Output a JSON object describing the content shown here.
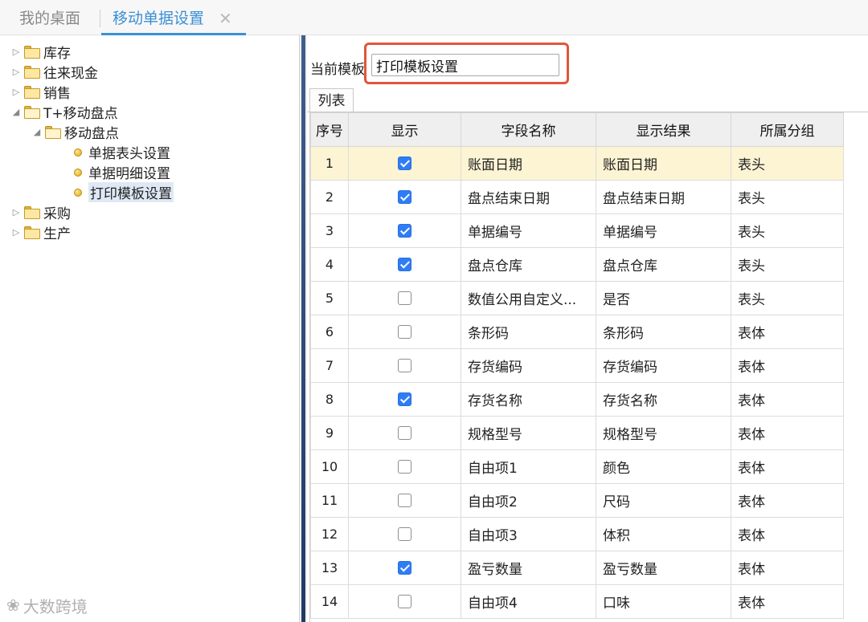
{
  "tabs": {
    "home_label": "我的桌面",
    "active_label": "移动单据设置",
    "close_glyph": "✕"
  },
  "tree": {
    "n0": "库存",
    "n1": "往来现金",
    "n2": "销售",
    "n3": "T+移动盘点",
    "n4": "移动盘点",
    "n5": "单据表头设置",
    "n6": "单据明细设置",
    "n7": "打印模板设置",
    "n8": "采购",
    "n9": "生产"
  },
  "template": {
    "label": "当前模板",
    "value": "打印模板设置"
  },
  "sub_tab_label": "列表",
  "grid": {
    "columns": [
      "序号",
      "显示",
      "字段名称",
      "显示结果",
      "所属分组"
    ],
    "rows": [
      {
        "no": "1",
        "checked": true,
        "field": "账面日期",
        "result": "账面日期",
        "group": "表头"
      },
      {
        "no": "2",
        "checked": true,
        "field": "盘点结束日期",
        "result": "盘点结束日期",
        "group": "表头"
      },
      {
        "no": "3",
        "checked": true,
        "field": "单据编号",
        "result": "单据编号",
        "group": "表头"
      },
      {
        "no": "4",
        "checked": true,
        "field": "盘点仓库",
        "result": "盘点仓库",
        "group": "表头"
      },
      {
        "no": "5",
        "checked": false,
        "field": "数值公用自定义...",
        "result": "是否",
        "group": "表头"
      },
      {
        "no": "6",
        "checked": false,
        "field": "条形码",
        "result": "条形码",
        "group": "表体"
      },
      {
        "no": "7",
        "checked": false,
        "field": "存货编码",
        "result": "存货编码",
        "group": "表体"
      },
      {
        "no": "8",
        "checked": true,
        "field": "存货名称",
        "result": "存货名称",
        "group": "表体"
      },
      {
        "no": "9",
        "checked": false,
        "field": "规格型号",
        "result": "规格型号",
        "group": "表体"
      },
      {
        "no": "10",
        "checked": false,
        "field": "自由项1",
        "result": "颜色",
        "group": "表体"
      },
      {
        "no": "11",
        "checked": false,
        "field": "自由项2",
        "result": "尺码",
        "group": "表体"
      },
      {
        "no": "12",
        "checked": false,
        "field": "自由项3",
        "result": "体积",
        "group": "表体"
      },
      {
        "no": "13",
        "checked": true,
        "field": "盈亏数量",
        "result": "盈亏数量",
        "group": "表体"
      },
      {
        "no": "14",
        "checked": false,
        "field": "自由项4",
        "result": "口味",
        "group": "表体"
      }
    ]
  },
  "watermark": {
    "text": "大数跨境"
  },
  "colors": {
    "accent": "#3b8fd4",
    "highlight": "#e2553b",
    "checkbox": "#2f7df6",
    "selected_row": "#fdf4d4"
  }
}
